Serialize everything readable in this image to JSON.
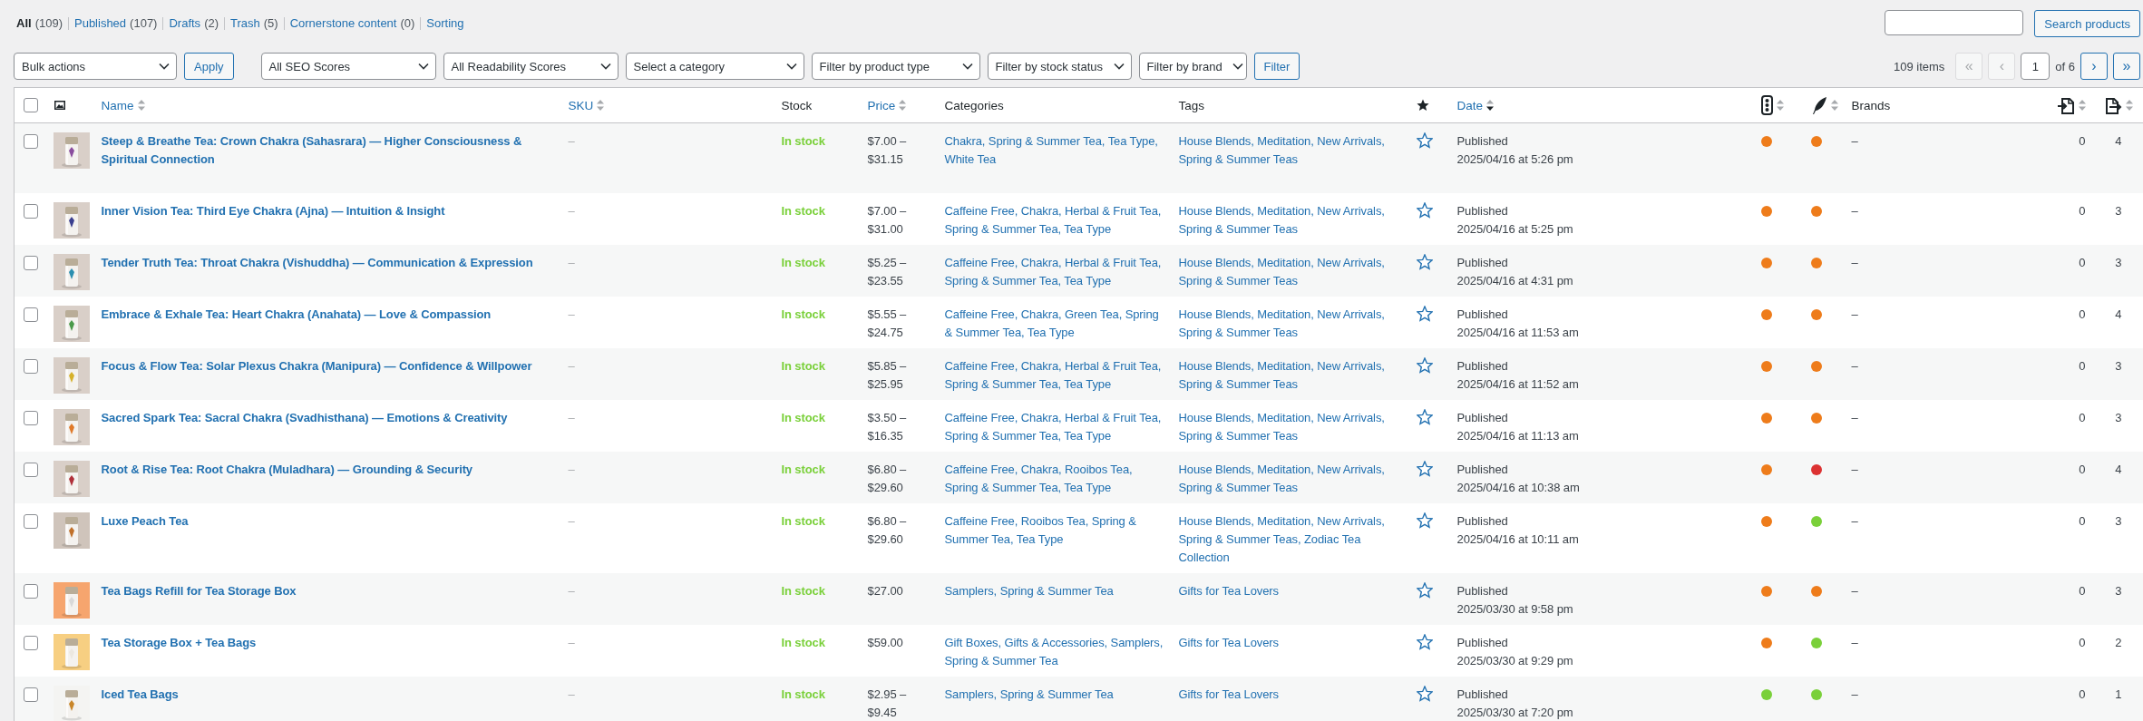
{
  "views": [
    {
      "label": "All",
      "count": "(109)",
      "selected": true
    },
    {
      "label": "Published",
      "count": "(107)",
      "selected": false
    },
    {
      "label": "Drafts",
      "count": "(2)",
      "selected": false
    },
    {
      "label": "Trash",
      "count": "(5)",
      "selected": false
    },
    {
      "label": "Cornerstone content",
      "count": "(0)",
      "selected": false
    },
    {
      "label": "Sorting",
      "selected": false
    }
  ],
  "search": {
    "button": "Search products"
  },
  "bulk": {
    "select": "Bulk actions",
    "button": "Apply"
  },
  "filters": {
    "selects": [
      "All SEO Scores",
      "All Readability Scores",
      "Select a category",
      "Filter by product type",
      "Filter by stock status",
      "Filter by brand"
    ],
    "button": "Filter"
  },
  "pagination": {
    "items": "109 items",
    "first": {
      "label": "«",
      "disabled": true
    },
    "prev": {
      "label": "‹",
      "disabled": true
    },
    "page": "1",
    "of": "of 6",
    "next": {
      "label": "›",
      "disabled": false
    },
    "last": {
      "label": "»",
      "disabled": false
    }
  },
  "table": {
    "select_all": {
      "checked": false
    },
    "columns": [
      {
        "kind": "icon"
      },
      {
        "label": "Name",
        "sortable": true,
        "sorted": false
      },
      {
        "label": "SKU",
        "sortable": true,
        "sorted": false
      },
      {
        "label": "Stock",
        "sortable": false
      },
      {
        "label": "Price",
        "sortable": true,
        "sorted": false
      },
      {
        "label": "Categories",
        "sortable": false
      },
      {
        "label": "Tags",
        "sortable": false
      },
      {
        "kind": "icon"
      },
      {
        "label": "Date",
        "sortable": true,
        "sorted": true
      },
      {
        "kind": "icon",
        "sortable": true,
        "sorted": false
      },
      {
        "kind": "icon",
        "sortable": true,
        "sorted": false
      },
      {
        "label": "Brands",
        "sortable": false
      },
      {
        "kind": "icon",
        "sortable": true,
        "sorted": false
      },
      {
        "kind": "icon",
        "sortable": true,
        "sorted": false
      }
    ],
    "rows": [
      {
        "checked": false,
        "name": "Steep & Breathe Tea: Crown Chakra (Sahasrara) — Higher Consciousness & Spiritual Connection",
        "sku": "–",
        "stock": "In stock",
        "price": "$7.00 – $31.15",
        "categories": "Chakra, Spring & Summer Tea, Tea Type, White Tea",
        "tags": "House Blends, Meditation, New Arrivals, Spring & Summer Teas",
        "featured": false,
        "status": "Published",
        "date": "2025/04/16 at 5:26 pm",
        "seo": {
          "color": "#ee7c1b"
        },
        "readability": {
          "color": "#ee7c1b"
        },
        "brands": "–",
        "column_13": "0",
        "column_14": "4"
      },
      {
        "checked": false,
        "name": "Inner Vision Tea: Third Eye Chakra (Ajna) — Intuition & Insight",
        "sku": "–",
        "stock": "In stock",
        "price": "$7.00 – $31.00",
        "categories": "Caffeine Free, Chakra, Herbal & Fruit Tea, Spring & Summer Tea, Tea Type",
        "tags": "House Blends, Meditation, New Arrivals, Spring & Summer Teas",
        "featured": false,
        "status": "Published",
        "date": "2025/04/16 at 5:25 pm",
        "seo": {
          "color": "#ee7c1b"
        },
        "readability": {
          "color": "#ee7c1b"
        },
        "brands": "–",
        "column_13": "0",
        "column_14": "3"
      },
      {
        "checked": false,
        "name": "Tender Truth Tea: Throat Chakra (Vishuddha) — Communication & Expression",
        "sku": "–",
        "stock": "In stock",
        "price": "$5.25 – $23.55",
        "categories": "Caffeine Free, Chakra, Herbal & Fruit Tea, Spring & Summer Tea, Tea Type",
        "tags": "House Blends, Meditation, New Arrivals, Spring & Summer Teas",
        "featured": false,
        "status": "Published",
        "date": "2025/04/16 at 4:31 pm",
        "seo": {
          "color": "#ee7c1b"
        },
        "readability": {
          "color": "#ee7c1b"
        },
        "brands": "–",
        "column_13": "0",
        "column_14": "3"
      },
      {
        "checked": false,
        "name": "Embrace & Exhale Tea: Heart Chakra (Anahata) — Love & Compassion",
        "sku": "–",
        "stock": "In stock",
        "price": "$5.55 – $24.75",
        "categories": "Caffeine Free, Chakra, Green Tea, Spring & Summer Tea, Tea Type",
        "tags": "House Blends, Meditation, New Arrivals, Spring & Summer Teas",
        "featured": false,
        "status": "Published",
        "date": "2025/04/16 at 11:53 am",
        "seo": {
          "color": "#ee7c1b"
        },
        "readability": {
          "color": "#ee7c1b"
        },
        "brands": "–",
        "column_13": "0",
        "column_14": "4"
      },
      {
        "checked": false,
        "name": "Focus & Flow Tea: Solar Plexus Chakra (Manipura) — Confidence & Willpower",
        "sku": "–",
        "stock": "In stock",
        "price": "$5.85 – $25.95",
        "categories": "Caffeine Free, Chakra, Herbal & Fruit Tea, Spring & Summer Tea, Tea Type",
        "tags": "House Blends, Meditation, New Arrivals, Spring & Summer Teas",
        "featured": false,
        "status": "Published",
        "date": "2025/04/16 at 11:52 am",
        "seo": {
          "color": "#ee7c1b"
        },
        "readability": {
          "color": "#ee7c1b"
        },
        "brands": "–",
        "column_13": "0",
        "column_14": "3"
      },
      {
        "checked": false,
        "name": "Sacred Spark Tea: Sacral Chakra (Svadhisthana) — Emotions & Creativity",
        "sku": "–",
        "stock": "In stock",
        "price": "$3.50 – $16.35",
        "categories": "Caffeine Free, Chakra, Herbal & Fruit Tea, Spring & Summer Tea, Tea Type",
        "tags": "House Blends, Meditation, New Arrivals, Spring & Summer Teas",
        "featured": false,
        "status": "Published",
        "date": "2025/04/16 at 11:13 am",
        "seo": {
          "color": "#ee7c1b"
        },
        "readability": {
          "color": "#ee7c1b"
        },
        "brands": "–",
        "column_13": "0",
        "column_14": "3"
      },
      {
        "checked": false,
        "name": "Root & Rise Tea: Root Chakra (Muladhara) — Grounding & Security",
        "sku": "–",
        "stock": "In stock",
        "price": "$6.80 – $29.60",
        "categories": "Caffeine Free, Chakra, Rooibos Tea, Spring & Summer Tea, Tea Type",
        "tags": "House Blends, Meditation, New Arrivals, Spring & Summer Teas",
        "featured": false,
        "status": "Published",
        "date": "2025/04/16 at 10:38 am",
        "seo": {
          "color": "#ee7c1b"
        },
        "readability": {
          "color": "#dc3232"
        },
        "brands": "–",
        "column_13": "0",
        "column_14": "4"
      },
      {
        "checked": false,
        "name": "Luxe Peach Tea",
        "sku": "–",
        "stock": "In stock",
        "price": "$6.80 – $29.60",
        "categories": "Caffeine Free, Rooibos Tea, Spring & Summer Tea, Tea Type",
        "tags": "House Blends, Meditation, New Arrivals, Spring & Summer Teas, Zodiac Tea Collection",
        "featured": false,
        "status": "Published",
        "date": "2025/04/16 at 10:11 am",
        "seo": {
          "color": "#ee7c1b"
        },
        "readability": {
          "color": "#7ad03a"
        },
        "brands": "–",
        "column_13": "0",
        "column_14": "3"
      },
      {
        "checked": false,
        "name": "Tea Bags Refill for Tea Storage Box",
        "sku": "–",
        "stock": "In stock",
        "price": "$27.00",
        "categories": "Samplers, Spring & Summer Tea",
        "tags": "Gifts for Tea Lovers",
        "featured": false,
        "status": "Published",
        "date": "2025/03/30 at 9:58 pm",
        "seo": {
          "color": "#ee7c1b"
        },
        "readability": {
          "color": "#ee7c1b"
        },
        "brands": "–",
        "column_13": "0",
        "column_14": "3"
      },
      {
        "checked": false,
        "name": "Tea Storage Box + Tea Bags",
        "sku": "–",
        "stock": "In stock",
        "price": "$59.00",
        "categories": "Gift Boxes, Gifts & Accessories, Samplers, Spring & Summer Tea",
        "tags": "Gifts for Tea Lovers",
        "featured": false,
        "status": "Published",
        "date": "2025/03/30 at 9:29 pm",
        "seo": {
          "color": "#ee7c1b"
        },
        "readability": {
          "color": "#7ad03a"
        },
        "brands": "–",
        "column_13": "0",
        "column_14": "2"
      },
      {
        "checked": false,
        "name": "Iced Tea Bags",
        "sku": "–",
        "stock": "In stock",
        "price": "$2.95 – $9.45",
        "categories": "Samplers, Spring & Summer Tea",
        "tags": "Gifts for Tea Lovers",
        "featured": false,
        "status": "Published",
        "date": "2025/03/30 at 7:20 pm",
        "seo": {
          "color": "#7ad03a"
        },
        "readability": {
          "color": "#7ad03a"
        },
        "brands": "–",
        "column_13": "0",
        "column_14": "1"
      }
    ]
  }
}
